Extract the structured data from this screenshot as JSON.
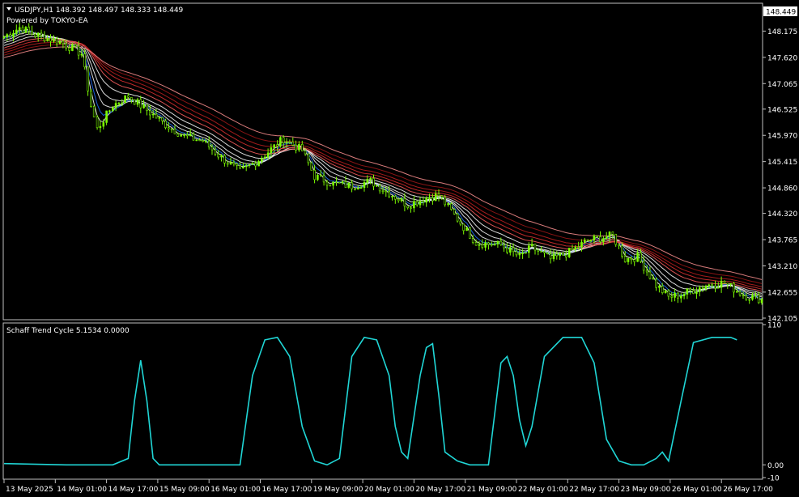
{
  "header": {
    "symbol_line": "USDJPY,H1  148.392 148.497 148.333 148.449",
    "powered_by": "Powered by TOKYO-EA"
  },
  "indicator": {
    "label": "Schaff Trend Cycle 5.1534 0.0000"
  },
  "colors": {
    "background": "#000000",
    "frame": "#c0c0c0",
    "bull_candle": "#7cfc00",
    "bear_candle": "#7cfc00",
    "ma_fast": "#ffffff",
    "ma_mid_blue": "#1e6fff",
    "ma_slow_red": "#ff2020",
    "stc_line": "#20d6d6",
    "price_box_bg": "#ffffff",
    "price_box_text": "#000000"
  },
  "chart_data": [
    {
      "type": "candlestick",
      "symbol": "USDJPY",
      "timeframe": "H1",
      "ylim": [
        142.105,
        148.73
      ],
      "y_ticks": [
        "148.175",
        "147.620",
        "147.065",
        "146.525",
        "145.970",
        "145.415",
        "144.860",
        "144.320",
        "143.765",
        "143.210",
        "142.655",
        "142.105"
      ],
      "current_price": "148.449",
      "x_tick_labels": [
        "13 May 2025",
        "14 May 01:00",
        "14 May 17:00",
        "15 May 09:00",
        "16 May 01:00",
        "16 May 17:00",
        "19 May 09:00",
        "20 May 01:00",
        "20 May 17:00",
        "21 May 09:00",
        "22 May 01:00",
        "22 May 17:00",
        "23 May 09:00",
        "26 May 01:00",
        "26 May 17:00"
      ],
      "close_path": [
        [
          0,
          148.05
        ],
        [
          5,
          148.25
        ],
        [
          10,
          148.1
        ],
        [
          18,
          147.95
        ],
        [
          25,
          147.7
        ],
        [
          28,
          146.6
        ],
        [
          30,
          146.1
        ],
        [
          35,
          146.6
        ],
        [
          40,
          146.8
        ],
        [
          45,
          146.55
        ],
        [
          52,
          146.2
        ],
        [
          58,
          145.95
        ],
        [
          64,
          145.85
        ],
        [
          70,
          145.5
        ],
        [
          76,
          145.2
        ],
        [
          82,
          145.45
        ],
        [
          90,
          145.9
        ],
        [
          96,
          145.65
        ],
        [
          100,
          145.1
        ],
        [
          106,
          144.95
        ],
        [
          112,
          144.9
        ],
        [
          118,
          145.0
        ],
        [
          124,
          144.75
        ],
        [
          130,
          144.5
        ],
        [
          136,
          144.65
        ],
        [
          140,
          144.7
        ],
        [
          146,
          144.2
        ],
        [
          152,
          143.7
        ],
        [
          160,
          143.65
        ],
        [
          166,
          143.4
        ],
        [
          170,
          143.6
        ],
        [
          176,
          143.35
        ],
        [
          182,
          143.5
        ],
        [
          188,
          143.75
        ],
        [
          196,
          143.85
        ],
        [
          200,
          143.35
        ],
        [
          204,
          143.4
        ],
        [
          210,
          142.8
        ],
        [
          214,
          142.55
        ],
        [
          218,
          142.6
        ],
        [
          222,
          142.7
        ],
        [
          226,
          142.8
        ],
        [
          232,
          142.85
        ],
        [
          238,
          142.6
        ],
        [
          244,
          142.5
        ]
      ],
      "ma_ribbon_end_values": [
        142.6,
        142.8,
        143.0
      ]
    },
    {
      "type": "line",
      "title": "Schaff Trend Cycle 5.1534 0.0000",
      "ylim": [
        -10,
        110
      ],
      "y_ticks": [
        "110",
        "0.00",
        "-10"
      ],
      "points": [
        [
          0,
          1
        ],
        [
          20,
          0
        ],
        [
          35,
          0
        ],
        [
          40,
          5
        ],
        [
          42,
          50
        ],
        [
          44,
          82
        ],
        [
          46,
          50
        ],
        [
          48,
          5
        ],
        [
          50,
          0
        ],
        [
          70,
          0
        ],
        [
          76,
          0
        ],
        [
          80,
          70
        ],
        [
          84,
          98
        ],
        [
          88,
          100
        ],
        [
          92,
          85
        ],
        [
          96,
          30
        ],
        [
          100,
          3
        ],
        [
          104,
          0
        ],
        [
          108,
          5
        ],
        [
          112,
          85
        ],
        [
          116,
          100
        ],
        [
          120,
          98
        ],
        [
          124,
          70
        ],
        [
          126,
          30
        ],
        [
          128,
          10
        ],
        [
          130,
          5
        ],
        [
          134,
          70
        ],
        [
          136,
          92
        ],
        [
          138,
          95
        ],
        [
          140,
          55
        ],
        [
          142,
          10
        ],
        [
          146,
          3
        ],
        [
          150,
          0
        ],
        [
          156,
          0
        ],
        [
          158,
          40
        ],
        [
          160,
          80
        ],
        [
          162,
          85
        ],
        [
          164,
          70
        ],
        [
          166,
          35
        ],
        [
          168,
          15
        ],
        [
          170,
          30
        ],
        [
          174,
          85
        ],
        [
          180,
          100
        ],
        [
          186,
          100
        ],
        [
          190,
          80
        ],
        [
          194,
          20
        ],
        [
          198,
          3
        ],
        [
          202,
          0
        ],
        [
          206,
          0
        ],
        [
          210,
          5
        ],
        [
          212,
          10
        ],
        [
          214,
          3
        ],
        [
          218,
          50
        ],
        [
          222,
          96
        ],
        [
          228,
          100
        ],
        [
          234,
          100
        ],
        [
          236,
          98
        ]
      ]
    }
  ]
}
